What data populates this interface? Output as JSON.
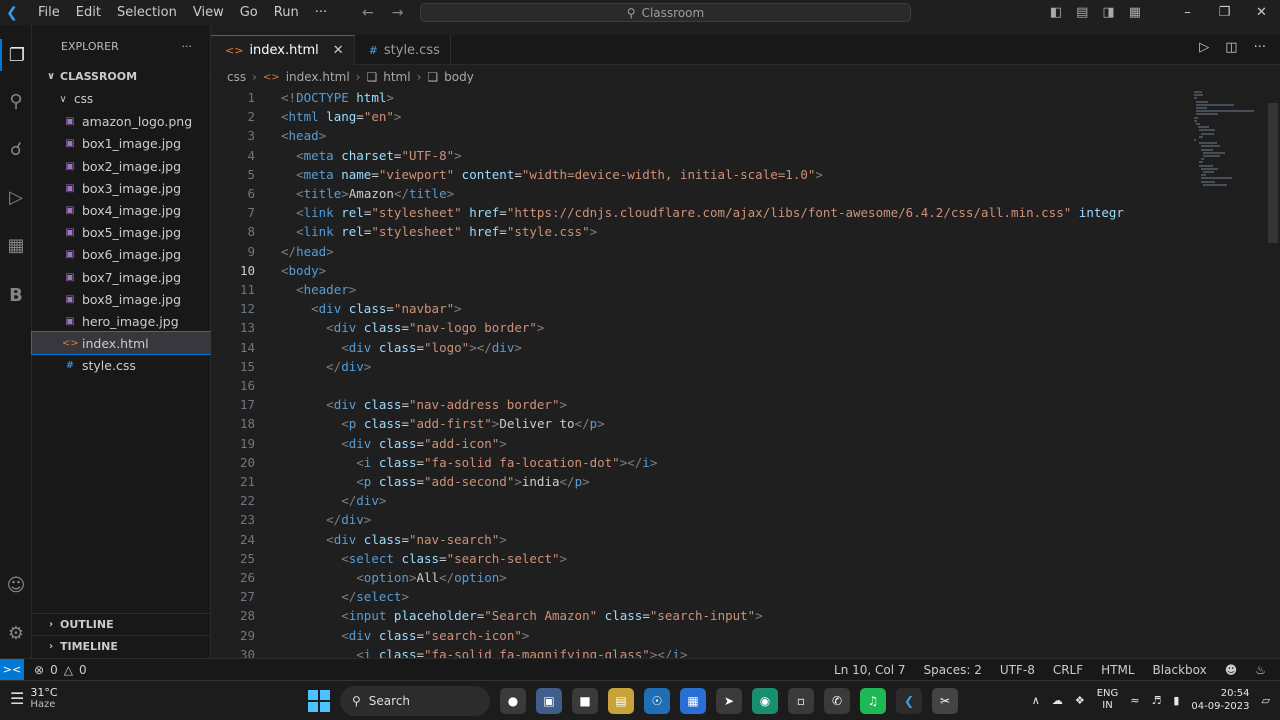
{
  "titlebar": {
    "menu": [
      "File",
      "Edit",
      "Selection",
      "View",
      "Go",
      "Run",
      "···"
    ],
    "search": "Classroom"
  },
  "explorer": {
    "title": "EXPLORER",
    "more": "···",
    "root": "CLASSROOM",
    "folder": "css",
    "files": [
      "amazon_logo.png",
      "box1_image.jpg",
      "box2_image.jpg",
      "box3_image.jpg",
      "box4_image.jpg",
      "box5_image.jpg",
      "box6_image.jpg",
      "box7_image.jpg",
      "box8_image.jpg",
      "hero_image.jpg"
    ],
    "root_files": [
      "index.html",
      "style.css"
    ],
    "outline": "OUTLINE",
    "timeline": "TIMELINE"
  },
  "tabs": [
    {
      "label": "index.html",
      "icon": "<>",
      "close": "✕"
    },
    {
      "label": "style.css",
      "icon": "#"
    }
  ],
  "breadcrumb": [
    "css",
    "index.html",
    "html",
    "body"
  ],
  "code_lines": [
    "<!DOCTYPE html>",
    "<html lang=\"en\">",
    "<head>",
    "  <meta charset=\"UTF-8\">",
    "  <meta name=\"viewport\" content=\"width=device-width, initial-scale=1.0\">",
    "  <title>Amazon</title>",
    "  <link rel=\"stylesheet\" href=\"https://cdnjs.cloudflare.com/ajax/libs/font-awesome/6.4.2/css/all.min.css\" integr",
    "  <link rel=\"stylesheet\" href=\"style.css\">",
    "</head>",
    "<body>",
    "  <header>",
    "    <div class=\"navbar\">",
    "      <div class=\"nav-logo border\">",
    "        <div class=\"logo\"></div>",
    "      </div>",
    "",
    "      <div class=\"nav-address border\">",
    "        <p class=\"add-first\">Deliver to</p>",
    "        <div class=\"add-icon\">",
    "          <i class=\"fa-solid fa-location-dot\"></i>",
    "          <p class=\"add-second\">india</p>",
    "        </div>",
    "      </div>",
    "      <div class=\"nav-search\">",
    "        <select class=\"search-select\">",
    "          <option>All</option>",
    "        </select>",
    "        <input placeholder=\"Search Amazon\" class=\"search-input\">",
    "        <div class=\"search-icon\">",
    "          <i class=\"fa-solid fa-magnifying-glass\"></i>"
  ],
  "current_line": 10,
  "statusbar": {
    "errors": "0",
    "warnings": "0",
    "position": "Ln 10, Col 7",
    "spaces": "Spaces: 2",
    "encoding": "UTF-8",
    "eol": "CRLF",
    "language": "HTML",
    "extension": "Blackbox"
  },
  "taskbar": {
    "temperature": "31°C",
    "weather": "Haze",
    "search": "Search",
    "lang1": "ENG",
    "lang2": "IN",
    "time": "20:54",
    "date": "04-09-2023"
  }
}
